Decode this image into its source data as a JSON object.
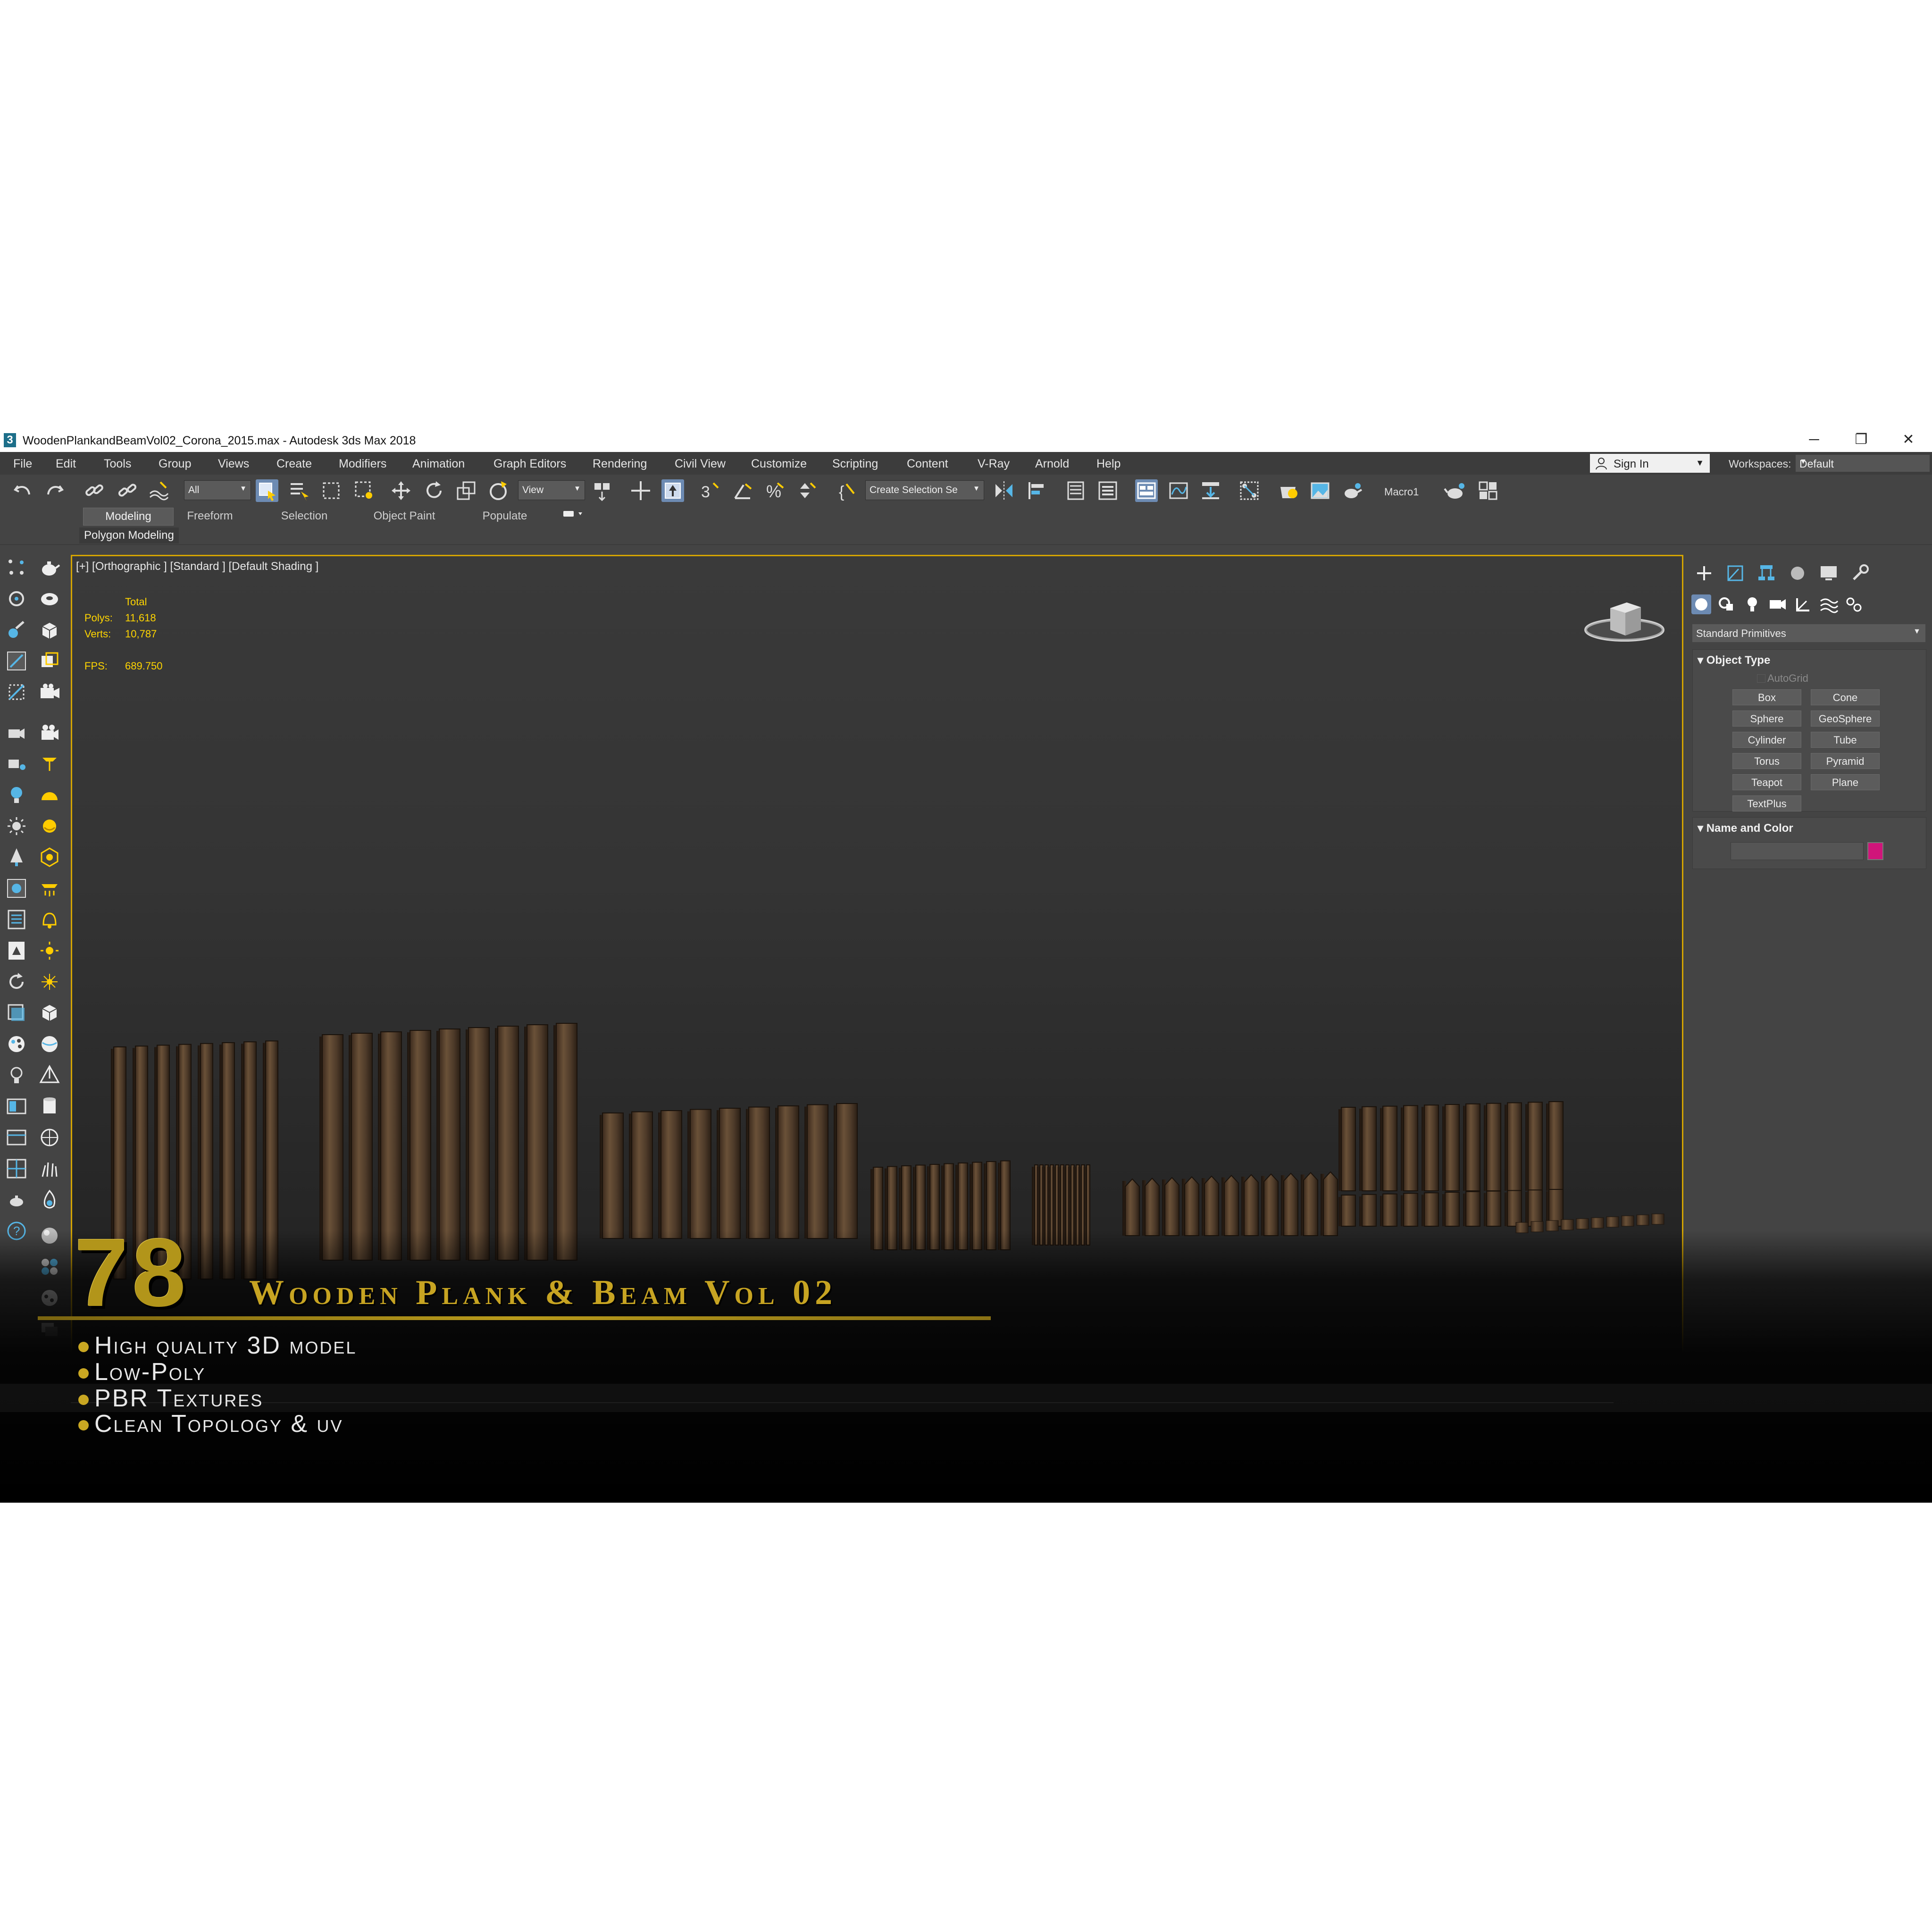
{
  "window": {
    "title": "WoodenPlankandBeamVol02_Corona_2015.max - Autodesk 3ds Max 2018",
    "app_icon": "3",
    "controls": [
      "─",
      "❐",
      "✕"
    ]
  },
  "menu": [
    "File",
    "Edit",
    "Tools",
    "Group",
    "Views",
    "Create",
    "Modifiers",
    "Animation",
    "Graph Editors",
    "Rendering",
    "Civil View",
    "Customize",
    "Scripting",
    "Content",
    "V-Ray",
    "Arnold",
    "Help"
  ],
  "account": {
    "sign_in": "Sign In",
    "workspaces_label": "Workspaces:",
    "workspace": "Default"
  },
  "toolbar": {
    "filter_value": "All",
    "ref_coord_value": "View",
    "selection_set_value": "Create Selection Se",
    "macro_label": "Macro1"
  },
  "ribbon": {
    "tabs": [
      "Modeling",
      "Freeform",
      "Selection",
      "Object Paint",
      "Populate"
    ],
    "active_tab": "Modeling",
    "sub_tab": "Polygon Modeling"
  },
  "viewport": {
    "label": "[+] [Orthographic ] [Standard ] [Default Shading ]",
    "stats": {
      "header": "Total",
      "polys_label": "Polys:",
      "polys": "11,618",
      "verts_label": "Verts:",
      "verts": "10,787",
      "fps_label": "FPS:",
      "fps": "689.750"
    },
    "highlight_color": "#d4a400"
  },
  "command_panel": {
    "category": "Standard Primitives",
    "object_type": {
      "header": "Object Type",
      "autogrid": "AutoGrid",
      "buttons": [
        "Box",
        "Cone",
        "Sphere",
        "GeoSphere",
        "Cylinder",
        "Tube",
        "Torus",
        "Pyramid",
        "Teapot",
        "Plane",
        "TextPlus"
      ]
    },
    "name_and_color": {
      "header": "Name and Color",
      "color": "#d0157a"
    }
  },
  "promo": {
    "number": "78",
    "title": "Wooden Plank & Beam Vol 02",
    "features": [
      "High quality 3D model",
      "Low-Poly",
      "PBR Textures",
      "Clean Topology & uv"
    ],
    "accent_color": "#c7a422"
  }
}
